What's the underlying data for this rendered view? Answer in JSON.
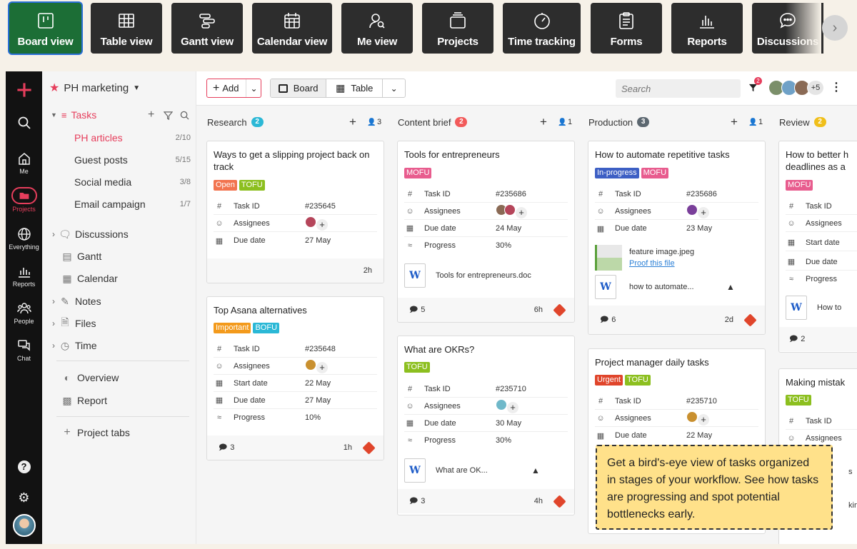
{
  "view_tabs": [
    {
      "label": "Board view",
      "icon": "board-icon",
      "active": true
    },
    {
      "label": "Table view",
      "icon": "table-icon"
    },
    {
      "label": "Gantt view",
      "icon": "gantt-icon"
    },
    {
      "label": "Calendar view",
      "icon": "calendar-icon"
    },
    {
      "label": "Me view",
      "icon": "me-icon"
    },
    {
      "label": "Projects",
      "icon": "projects-icon"
    },
    {
      "label": "Time tracking",
      "icon": "timer-icon"
    },
    {
      "label": "Forms",
      "icon": "forms-icon"
    },
    {
      "label": "Reports",
      "icon": "reports-icon"
    },
    {
      "label": "Discussions",
      "icon": "discussions-icon"
    }
  ],
  "rail": {
    "items": [
      {
        "label": "Me"
      },
      {
        "label": "Projects"
      },
      {
        "label": "Everything"
      },
      {
        "label": "Reports"
      },
      {
        "label": "People"
      },
      {
        "label": "Chat"
      }
    ]
  },
  "sidebar": {
    "project": "PH marketing",
    "tasks_label": "Tasks",
    "task_lists": [
      {
        "label": "PH articles",
        "count": "2/10"
      },
      {
        "label": "Guest posts",
        "count": "5/15"
      },
      {
        "label": "Social media",
        "count": "3/8"
      },
      {
        "label": "Email campaign",
        "count": "1/7"
      }
    ],
    "sections": [
      {
        "label": "Discussions"
      },
      {
        "label": "Gantt"
      },
      {
        "label": "Calendar"
      },
      {
        "label": "Notes"
      },
      {
        "label": "Files"
      },
      {
        "label": "Time"
      }
    ],
    "extra": [
      {
        "label": "Overview"
      },
      {
        "label": "Report"
      }
    ],
    "project_tabs": "Project tabs"
  },
  "toolbar": {
    "add": "Add",
    "board": "Board",
    "table": "Table",
    "search_placeholder": "Search",
    "filter_count": "2",
    "avatars_more": "+5"
  },
  "colors": {
    "green": "#1c6e36",
    "open": "#f2744f",
    "tofu": "#8cbf1f",
    "mofu": "#e85c8e",
    "bofu": "#2bb8d6",
    "important": "#f39a1c",
    "inprogress": "#3d5fc4",
    "urgent": "#e0452b"
  },
  "columns": [
    {
      "name": "Research",
      "count": "2",
      "people": "3",
      "color": "#2bb8d6"
    },
    {
      "name": "Content brief",
      "count": "2",
      "people": "1",
      "color": "#f25a5a"
    },
    {
      "name": "Production",
      "count": "3",
      "people": "1",
      "color": "#5c6770"
    },
    {
      "name": "Review",
      "count": "2",
      "color": "#f0bf1a"
    }
  ],
  "labels": {
    "task_id": "Task ID",
    "assignees": "Assignees",
    "start_date": "Start date",
    "due_date": "Due date",
    "progress": "Progress"
  },
  "cards": {
    "c1": {
      "title": "Ways to get a slipping project back on track",
      "tags": [
        "Open",
        "TOFU"
      ],
      "task_id": "#235645",
      "due": "27 May",
      "time": "2h"
    },
    "c2": {
      "title": "Top Asana alternatives",
      "tags": [
        "Important",
        "BOFU"
      ],
      "task_id": "#235648",
      "start": "22 May",
      "due": "27 May",
      "progress": "10%",
      "comments": "3",
      "time": "1h"
    },
    "c3": {
      "title": "Tools for entrepreneurs",
      "tags": [
        "MOFU"
      ],
      "task_id": "#235686",
      "due": "24 May",
      "progress": "30%",
      "file": "Tools for entrepreneurs.doc",
      "comments": "5",
      "time": "6h"
    },
    "c4": {
      "title": "What are OKRs?",
      "tags": [
        "TOFU"
      ],
      "task_id": "#235710",
      "due": "30 May",
      "progress": "30%",
      "file": "What are OK...",
      "comments": "3",
      "time": "4h"
    },
    "c5": {
      "title": "How to automate repetitive tasks",
      "tags": [
        "In-progress",
        "MOFU"
      ],
      "task_id": "#235686",
      "due": "23 May",
      "file1": "feature image.jpeg",
      "proof": "Proof this file",
      "file2": "how to automate...",
      "comments": "6",
      "time": "2d"
    },
    "c6": {
      "title": "Project manager daily tasks",
      "tags": [
        "Urgent",
        "TOFU"
      ],
      "task_id": "#235710",
      "due": "22 May"
    },
    "c7": {
      "title": "How to better h",
      "title2": "deadlines as a",
      "tags": [
        "MOFU"
      ],
      "file": "How to",
      "comments": "2"
    },
    "c8": {
      "title": "Making mistak",
      "tags": [
        "TOFU"
      ],
      "frag1": "s",
      "frag2": "king"
    }
  },
  "tooltip": "Get a bird's-eye view of tasks organized in stages of your workflow. See how tasks are progressing and spot potential bottlenecks early."
}
